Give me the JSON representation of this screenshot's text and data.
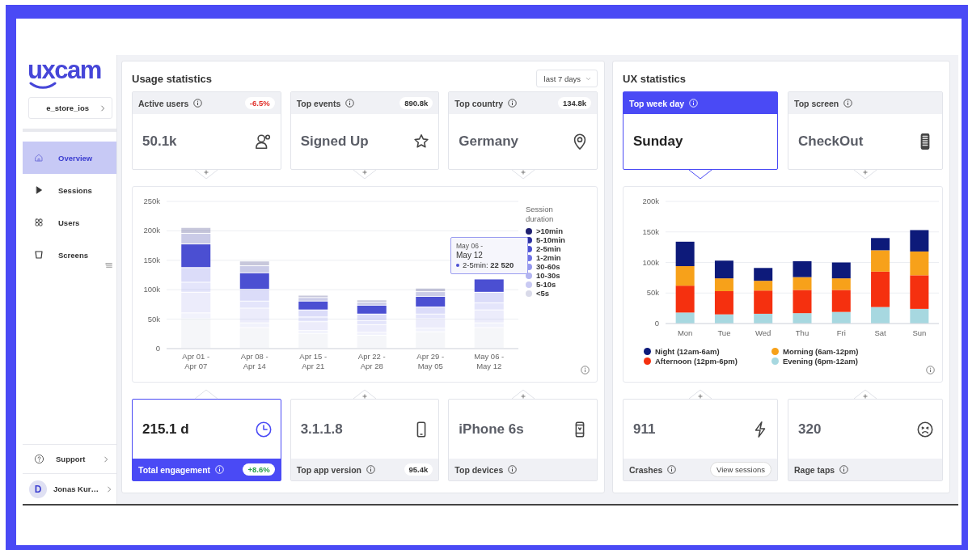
{
  "sidebar": {
    "logo": "uxcam",
    "app_selector": "e_store_ios",
    "nav": [
      {
        "label": "Overview",
        "selected": true
      },
      {
        "label": "Sessions",
        "selected": false
      },
      {
        "label": "Users",
        "selected": false
      },
      {
        "label": "Screens",
        "selected": false
      }
    ],
    "support": "Support",
    "user": {
      "initial": "D",
      "name": "Jonas Kur…"
    }
  },
  "usage_statistics": {
    "title": "Usage statistics",
    "period": "last 7 days",
    "top_cards": [
      {
        "label": "Active users",
        "value": "50.1k",
        "badge": "-6.5%",
        "color": "#e0302a",
        "selected": false
      },
      {
        "label": "Top events",
        "value": "Signed Up",
        "badge": "890.8k",
        "selected": false
      },
      {
        "label": "Top country",
        "value": "Germany",
        "badge": "134.8k",
        "selected": false
      }
    ],
    "chart": {
      "legend_title": "Session duration",
      "series_states": [
        {
          "highlighted": false
        },
        {
          "highlighted": false
        },
        {
          "highlighted": true
        },
        {
          "highlighted": false
        },
        {
          "highlighted": false
        },
        {
          "highlighted": false
        },
        {
          "highlighted": false
        },
        {
          "highlighted": false
        }
      ],
      "tooltip": {
        "title": "May 06 -",
        "subtitle": "May 12",
        "text": "2-5min: **22 520**"
      },
      "chart_data": {
        "type": "bar",
        "stacked": true,
        "grid": true,
        "legend": true,
        "categories": [
          "Apr 01 - Apr 07",
          "Apr 08 - Apr 14",
          "Apr 15 - Apr 21",
          "Apr 22 - Apr 28",
          "Apr 29 - May 05",
          "May 06 - May 12"
        ],
        "ylim": [
          0,
          250000
        ],
        "yticks": [
          {
            "value": 0,
            "label": "0"
          },
          {
            "value": 50000,
            "label": "50k"
          },
          {
            "value": 100000,
            "label": "100k"
          },
          {
            "value": 150000,
            "label": "150k"
          },
          {
            "value": 200000,
            "label": "200k"
          },
          {
            "value": 250000,
            "label": "250k"
          }
        ],
        "series": [
          {
            "name": ">10min",
            "color": "#1f2070",
            "values": [
              10000,
              8000,
              4000,
              4000,
              6000,
              0
            ]
          },
          {
            "name": "5-10min",
            "color": "#2c2fa0",
            "values": [
              18000,
              12000,
              6000,
              5000,
              8000,
              0
            ]
          },
          {
            "name": "2-5min",
            "color": "#4b4fd2",
            "values": [
              40000,
              28000,
              15000,
              15000,
              18000,
              22520
            ]
          },
          {
            "name": "1-2min",
            "color": "#6e72e6",
            "values": [
              25000,
              20000,
              12000,
              11000,
              12000,
              18000
            ]
          },
          {
            "name": "30-60s",
            "color": "#9598ee",
            "values": [
              17000,
              12000,
              8000,
              7000,
              8000,
              12000
            ]
          },
          {
            "name": "10-30s",
            "color": "#b3b5f1",
            "values": [
              35000,
              25000,
              15000,
              13000,
              16000,
              22000
            ]
          },
          {
            "name": "5-10s",
            "color": "#c9caf3",
            "values": [
              10000,
              8000,
              5000,
              5000,
              6000,
              8000
            ]
          },
          {
            "name": "<5s",
            "color": "#d9dae9",
            "values": [
              50000,
              35000,
              25000,
              22000,
              28000,
              35000
            ]
          }
        ]
      }
    },
    "bottom_cards": [
      {
        "label": "Total engagement",
        "value": "215.1 d",
        "badge": "+8.6%",
        "color": "#27a04a",
        "selected": true
      },
      {
        "label": "Top app version",
        "value": "3.1.1.8",
        "badge": "95.4k",
        "selected": false
      },
      {
        "label": "Top devices",
        "value": "iPhone 6s",
        "selected": false
      }
    ]
  },
  "ux_statistics": {
    "title": "UX statistics",
    "top_cards": [
      {
        "label": "Top week day",
        "value": "Sunday",
        "selected": true
      },
      {
        "label": "Top screen",
        "value": "CheckOut",
        "selected": false
      }
    ],
    "chart": {
      "chart_data": {
        "type": "bar",
        "stacked": true,
        "grid": true,
        "legend": true,
        "categories": [
          "Mon",
          "Tue",
          "Wed",
          "Thu",
          "Fri",
          "Sat",
          "Sun"
        ],
        "ylim": [
          0,
          200000
        ],
        "yticks": [
          {
            "value": 0,
            "label": "0"
          },
          {
            "value": 50000,
            "label": "50k"
          },
          {
            "value": 100000,
            "label": "100k"
          },
          {
            "value": 150000,
            "label": "150k"
          },
          {
            "value": 200000,
            "label": "200k"
          }
        ],
        "series": [
          {
            "name": "Night (12am-6am)",
            "color": "#0d1a7a",
            "values": [
              40000,
              29000,
              21000,
              26000,
              26000,
              20000,
              35000
            ]
          },
          {
            "name": "Morning (6am-12pm)",
            "color": "#f7a11a",
            "values": [
              32000,
              21000,
              16000,
              21000,
              19000,
              35000,
              39000
            ]
          },
          {
            "name": "Afternoon (12pm-6pm)",
            "color": "#f5300f",
            "values": [
              44000,
              38000,
              38000,
              38000,
              36000,
              58000,
              55000
            ]
          },
          {
            "name": "Evening (6pm-12am)",
            "color": "#a7d8e0",
            "values": [
              18000,
              15000,
              16000,
              17000,
              19000,
              27000,
              24000
            ]
          }
        ]
      }
    },
    "bottom_cards": [
      {
        "label": "Crashes",
        "value": "911",
        "action": "View sessions",
        "selected": false
      },
      {
        "label": "Rage taps",
        "value": "320",
        "selected": false
      }
    ]
  }
}
